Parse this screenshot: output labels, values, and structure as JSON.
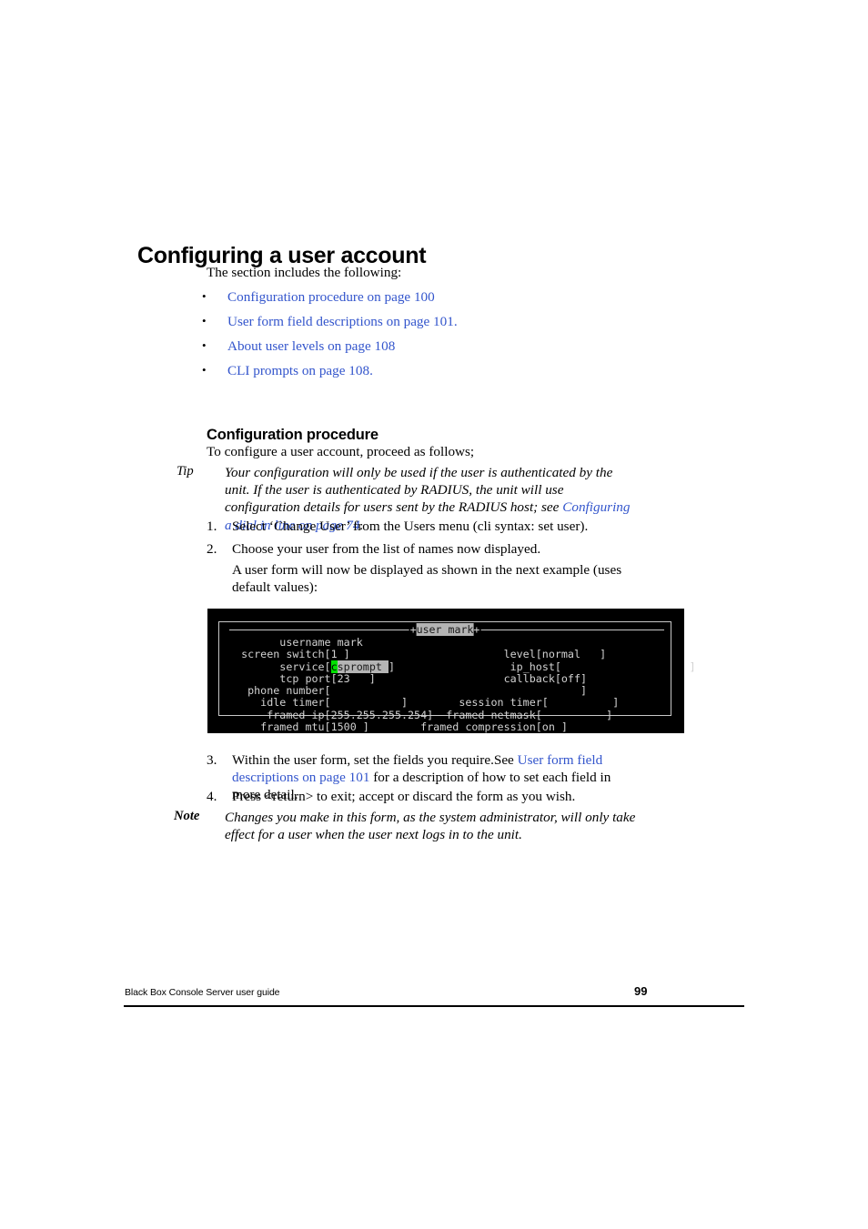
{
  "page": {
    "title": "Configuring a user account",
    "intro": "The section includes the following:",
    "links": [
      "Configuration procedure on page 100",
      "User form field descriptions on page 101.",
      "About user levels on page 108",
      "CLI prompts on page 108."
    ],
    "bullet_glyph": "•"
  },
  "section": {
    "heading": "Configuration procedure",
    "lead": "To configure a user account, proceed as follows;"
  },
  "tip": {
    "label": "Tip",
    "text_before": "Your configuration will only be used if the user is authenticated by the unit. If the user is authenticated by RADIUS, the unit will use configuration details for users sent by the RADIUS host; see ",
    "link": "Configuring a dial in line on page 74",
    "text_after": "."
  },
  "steps": {
    "one": {
      "num": "1.",
      "text": "Select ‘Change User’ from the Users menu (cli syntax: set user)."
    },
    "two": {
      "num": "2.",
      "text": "Choose your user from the list of names now displayed."
    },
    "two_sub": "A user form will now be displayed as shown in the next example (uses default values):",
    "three": {
      "num": "3.",
      "text_before": "Within the user form, set the fields you require.See ",
      "link": "User form field descriptions on page 101",
      "text_after": " for a description of how to set each field in more detail."
    },
    "four": {
      "num": "4.",
      "text": "Press <return> to exit; accept or discard the form as you wish."
    }
  },
  "note": {
    "label": "Note",
    "text": "Changes you make in this form, as the system administrator, will only take effect for a user when the user next logs in to the unit."
  },
  "terminal": {
    "title_prefix": "+",
    "title_text": "user mark",
    "title_suffix": "+",
    "cursor_char": "c",
    "service_value_rest": "sprompt ",
    "lines": {
      "l1": "        username mark",
      "l2": "  screen switch[1 ]                        level[normal   ]",
      "l3_left": "        service[",
      "l3_right": "]                  ip_host[                    ]",
      "l4": "        tcp port[23   ]                    callback[off]",
      "l5": "   phone number[                                       ]",
      "l6": "     idle timer[           ]        session timer[          ]",
      "l7": "      framed ip[255.255.255.254]  framed netmask[          ]",
      "l8": "     framed mtu[1500 ]        framed compression[on ]"
    },
    "colors": {
      "background": "#000000",
      "text": "#d2d2d2",
      "cursor": "#00e000",
      "highlight": "#b4b4b4"
    }
  },
  "footer": {
    "left": "Black Box Console Server user guide",
    "page_number": "99"
  }
}
